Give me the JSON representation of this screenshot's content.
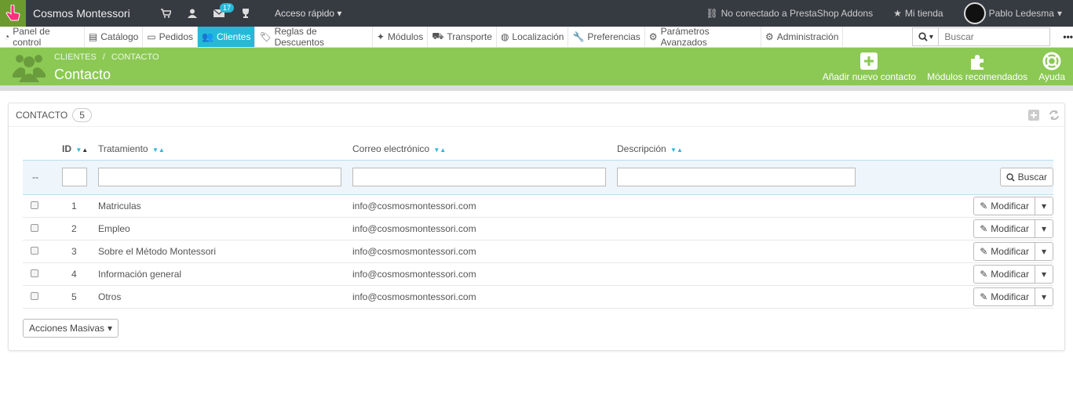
{
  "topbar": {
    "shop_name": "Cosmos Montessori",
    "notifications_count": "17",
    "quick_access": "Acceso rápido",
    "addons": "No conectado a PrestaShop Addons",
    "my_store": "Mi tienda",
    "user_name": "Pablo Ledesma"
  },
  "nav": {
    "items": [
      {
        "label": "Panel de control",
        "icon": "dashboard-icon"
      },
      {
        "label": "Catálogo",
        "icon": "book-icon"
      },
      {
        "label": "Pedidos",
        "icon": "credit-card-icon"
      },
      {
        "label": "Clientes",
        "icon": "users-icon"
      },
      {
        "label": "Reglas de Descuentos",
        "icon": "tags-icon"
      },
      {
        "label": "Módulos",
        "icon": "puzzle-icon"
      },
      {
        "label": "Transporte",
        "icon": "truck-icon"
      },
      {
        "label": "Localización",
        "icon": "globe-icon"
      },
      {
        "label": "Preferencias",
        "icon": "wrench-icon"
      },
      {
        "label": "Parámetros Avanzados",
        "icon": "cogs-icon"
      },
      {
        "label": "Administración",
        "icon": "gear-icon"
      }
    ],
    "search_placeholder": "Buscar"
  },
  "page_header": {
    "breadcrumb": [
      "CLIENTES",
      "/",
      "CONTACTO"
    ],
    "title": "Contacto",
    "toolbar": {
      "add": "Añadir nuevo contacto",
      "modules": "Módulos recomendados",
      "help": "Ayuda"
    }
  },
  "panel": {
    "title": "CONTACTO",
    "count": "5",
    "columns": {
      "id": "ID",
      "title": "Tratamiento",
      "email": "Correo electrónico",
      "description": "Descripción"
    },
    "filter_placeholder": "--",
    "search_button": "Buscar",
    "edit_label": "Modificar",
    "rows": [
      {
        "id": "1",
        "title": "Matriculas",
        "email": "info@cosmosmontessori.com",
        "description": ""
      },
      {
        "id": "2",
        "title": "Empleo",
        "email": "info@cosmosmontessori.com",
        "description": ""
      },
      {
        "id": "3",
        "title": "Sobre el Método Montessori",
        "email": "info@cosmosmontessori.com",
        "description": ""
      },
      {
        "id": "4",
        "title": "Información general",
        "email": "info@cosmosmontessori.com",
        "description": ""
      },
      {
        "id": "5",
        "title": "Otros",
        "email": "info@cosmosmontessori.com",
        "description": ""
      }
    ],
    "bulk_actions": "Acciones Masivas"
  },
  "colors": {
    "header_green": "#8bc954",
    "active_nav": "#25b9d7",
    "topbar": "#363a41"
  }
}
